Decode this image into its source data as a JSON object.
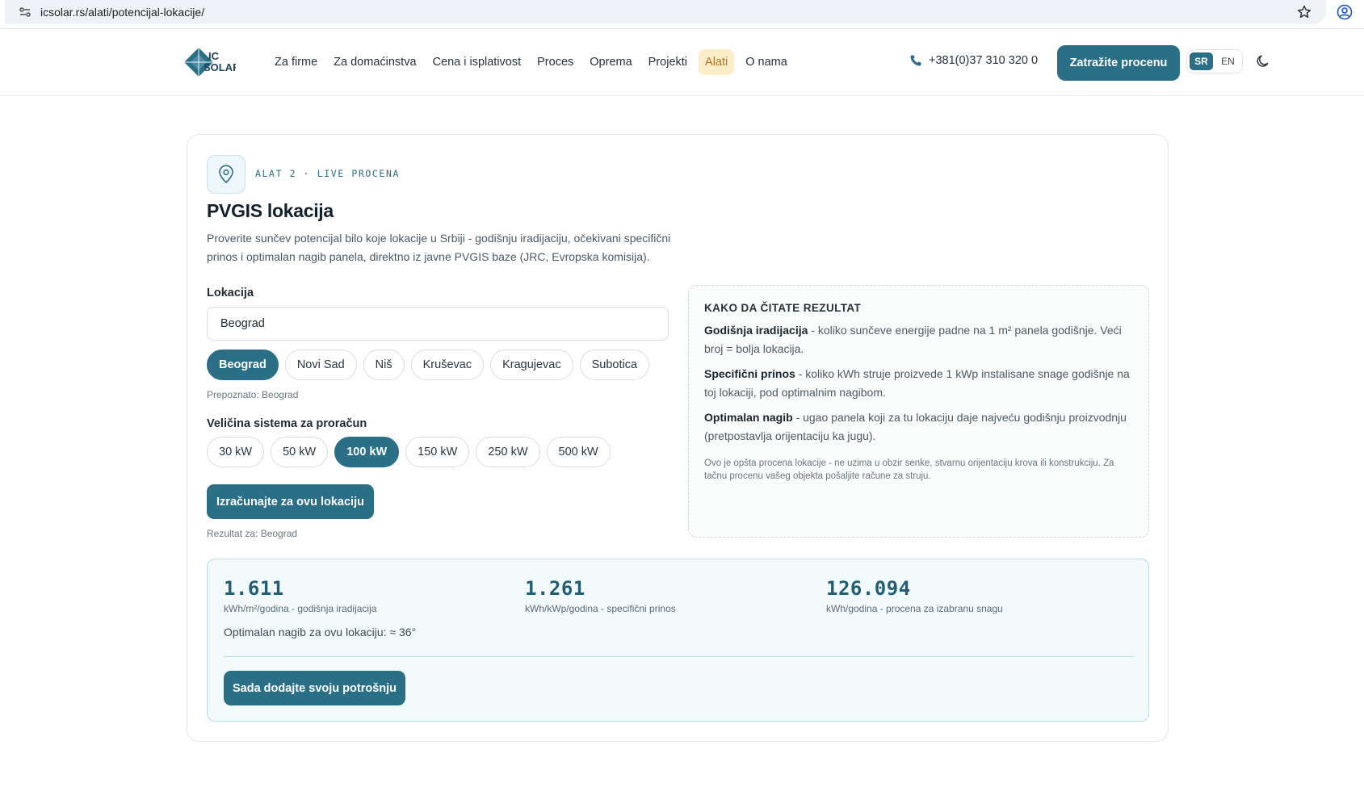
{
  "browser": {
    "url": "icsolar.rs/alati/potencijal-lokacije/"
  },
  "header": {
    "logo_text": "IC SOLAR",
    "nav": [
      {
        "label": "Za firme"
      },
      {
        "label": "Za domaćinstva"
      },
      {
        "label": "Cena i isplativost"
      },
      {
        "label": "Proces"
      },
      {
        "label": "Oprema"
      },
      {
        "label": "Projekti"
      },
      {
        "label": "Alati",
        "active": true
      },
      {
        "label": "O nama"
      }
    ],
    "phone": "+381(0)37 310 320 0",
    "cta": "Zatražite procenu",
    "lang": {
      "sr": "SR",
      "en": "EN",
      "active": "SR"
    }
  },
  "tool": {
    "eyebrow": "ALAT 2 · LIVE PROCENA",
    "title": "PVGIS lokacija",
    "description": "Proverite sunčev potencijal bilo koje lokacije u Srbiji - godišnju iradijaciju, očekivani specifični prinos i optimalan nagib panela, direktno iz javne PVGIS baze (JRC, Evropska komisija).",
    "location_label": "Lokacija",
    "location_value": "Beograd",
    "cities": [
      "Beograd",
      "Novi Sad",
      "Niš",
      "Kruševac",
      "Kragujevac",
      "Subotica"
    ],
    "active_city": "Beograd",
    "recognized": "Prepoznato: Beograd",
    "size_label": "Veličina sistema za proračun",
    "sizes": [
      "30 kW",
      "50 kW",
      "100 kW",
      "150 kW",
      "250 kW",
      "500 kW"
    ],
    "active_size": "100 kW",
    "calc_button": "Izračunajte za ovu lokaciju",
    "result_for": "Rezultat za: Beograd"
  },
  "info": {
    "title": "KAKO DA ČITATE REZULTAT",
    "items": [
      {
        "term": "Godišnja iradijacija",
        "text": " - koliko sunčeve energije padne na 1 m² panela godišnje. Veći broj = bolja lokacija."
      },
      {
        "term": "Specifični prinos",
        "text": " - koliko kWh struje proizvede 1 kWp instalisane snage godišnje na toj lokaciji, pod optimalnim nagibom."
      },
      {
        "term": "Optimalan nagib",
        "text": " - ugao panela koji za tu lokaciju daje najveću godišnju proizvodnju (pretpostavlja orijentaciju ka jugu)."
      }
    ],
    "note": "Ovo je opšta procena lokacije - ne uzima u obzir senke, stvarnu orijentaciju krova ili konstrukciju. Za tačnu procenu vašeg objekta pošaljite račune za struju."
  },
  "results": {
    "metrics": [
      {
        "value": "1.611",
        "label": "kWh/m²/godina - godišnja iradijacija"
      },
      {
        "value": "1.261",
        "label": "kWh/kWp/godina - specifični prinos"
      },
      {
        "value": "126.094",
        "label": "kWh/godina - procena za izabranu snagu"
      }
    ],
    "tilt": "Optimalan nagib za ovu lokaciju: ≈ 36°",
    "add_button": "Sada dodajte svoju potrošnju"
  }
}
